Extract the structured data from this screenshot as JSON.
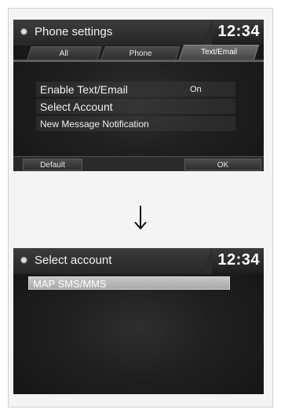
{
  "screen1": {
    "title": "Phone settings",
    "clock": "12:34",
    "icon": "gear-icon",
    "tabs": [
      {
        "label": "All",
        "selected": false
      },
      {
        "label": "Phone",
        "selected": false
      },
      {
        "label": "Text/Email",
        "selected": true
      }
    ],
    "items": [
      {
        "label": "Enable Text/Email",
        "value": "On"
      },
      {
        "label": "Select Account"
      },
      {
        "label": "New Message Notification"
      }
    ],
    "buttons": {
      "default": "Default",
      "ok": "OK"
    }
  },
  "arrow": "down-arrow-icon",
  "screen2": {
    "title": "Select account",
    "clock": "12:34",
    "icon": "gear-icon",
    "items": [
      {
        "label": "MAP SMS/MMS",
        "selected": true
      }
    ]
  }
}
